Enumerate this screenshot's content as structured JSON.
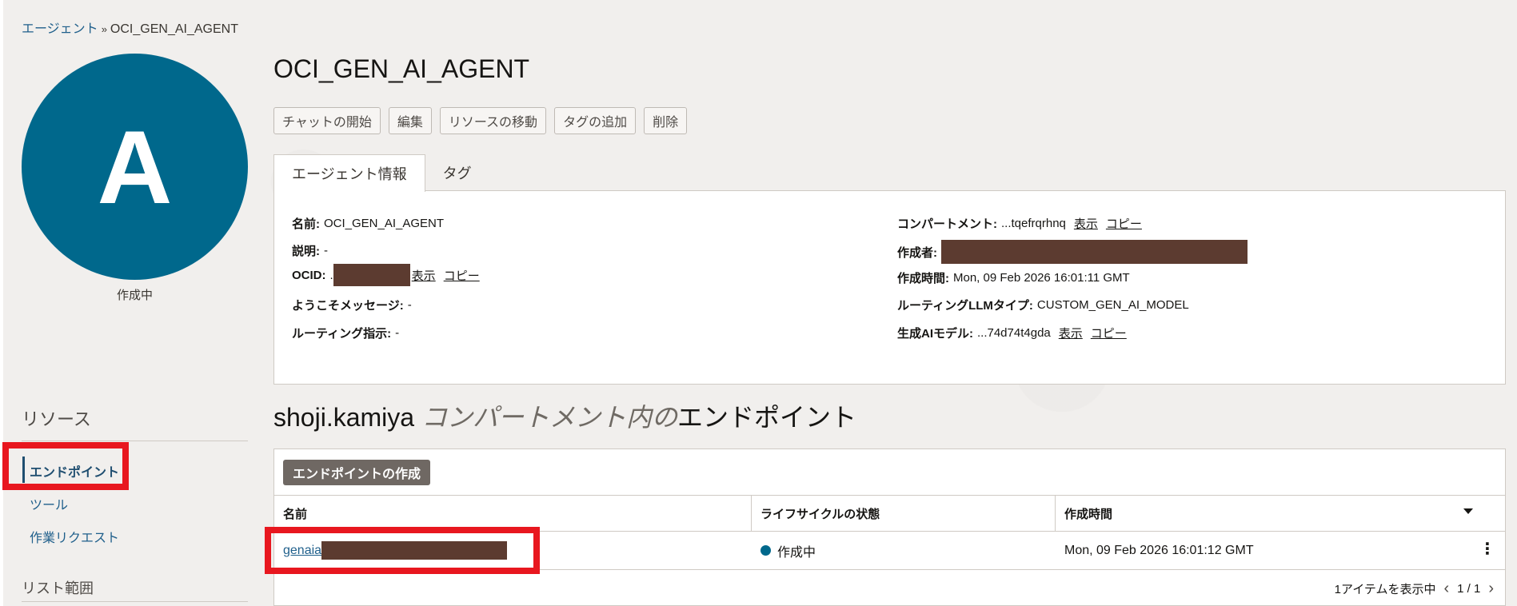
{
  "breadcrumb": {
    "parent": "エージェント",
    "separator": "»",
    "current": "OCI_GEN_AI_AGENT"
  },
  "avatar": {
    "letter": "A",
    "status": "作成中",
    "color": "#00688c"
  },
  "left_nav": {
    "resources_title": "リソース",
    "items": [
      {
        "label": "エンドポイント",
        "active": true
      },
      {
        "label": "ツール",
        "active": false
      },
      {
        "label": "作業リクエスト",
        "active": false
      }
    ],
    "list_scope_title": "リスト範囲"
  },
  "page_title": "OCI_GEN_AI_AGENT",
  "actions": [
    "チャットの開始",
    "編集",
    "リソースの移動",
    "タグの追加",
    "削除"
  ],
  "tabs": [
    "エージェント情報",
    "タグ"
  ],
  "info": {
    "name_label": "名前:",
    "name_value": "OCI_GEN_AI_AGENT",
    "desc_label": "説明:",
    "desc_value": "-",
    "ocid_label": "OCID:",
    "ocid_prefix": ".",
    "welcome_label": "ようこそメッセージ:",
    "welcome_value": "-",
    "routing_label": "ルーティング指示:",
    "routing_value": "-",
    "compartment_label": "コンパートメント:",
    "compartment_value": "...tqefrqrhnq",
    "creator_label": "作成者:",
    "created_label": "作成時間:",
    "created_value": "Mon, 09 Feb 2026 16:01:11 GMT",
    "llm_type_label": "ルーティングLLMタイプ:",
    "llm_type_value": "CUSTOM_GEN_AI_MODEL",
    "model_label": "生成AIモデル:",
    "model_value": "...74d74t4gda",
    "show_link": "表示",
    "copy_link": "コピー"
  },
  "section": {
    "compartment": "shoji.kamiya",
    "middle": "コンパートメント内の",
    "suffix": "エンドポイント"
  },
  "table": {
    "create_button": "エンドポイントの作成",
    "headers": [
      "名前",
      "ライフサイクルの状態",
      "作成時間"
    ],
    "row": {
      "name": "genaia",
      "state": "作成中",
      "created": "Mon, 09 Feb 2026 16:01:12 GMT"
    },
    "footer_count": "1アイテムを表示中",
    "footer_pages": "1 / 1"
  },
  "colors": {
    "highlight": "#e8171f",
    "redaction": "#5c3b30",
    "accent": "#00688c"
  }
}
